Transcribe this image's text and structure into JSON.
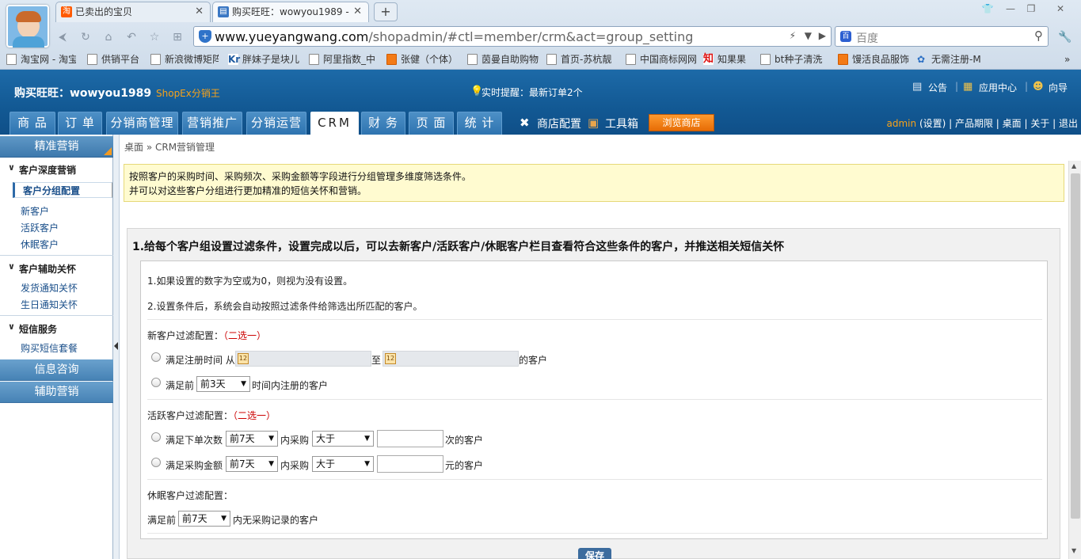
{
  "browser": {
    "tabs": [
      {
        "label": "已卖出的宝贝",
        "icon": "taobao-icon",
        "active": false
      },
      {
        "label": "购买旺旺：wowyou1989 -",
        "icon": "page-icon",
        "active": true
      }
    ],
    "new_tab": "+",
    "url_host": "www.yueyangwang.com",
    "url_path": "/shopadmin/#ctl=member/crm&act=group_setting",
    "search_placeholder": "百度",
    "bookmarks": [
      "淘宝网 - 淘宝",
      "供销平台",
      "新浪微博矩阵",
      "胖妹子是块儿",
      "阿里指数_中",
      "张健（个体）",
      "茵曼自助购物",
      "首页-苏杭靓",
      "中国商标网网",
      "知果果",
      "bt种子清洗",
      "馒活良品服饰",
      "无需注册-M"
    ],
    "bookmarks_more": "»"
  },
  "header": {
    "site_title": "购买旺旺：wowyou1989",
    "brand": "ShopEx分销王",
    "alert": "实时提醒：最新订单2个",
    "top_links": [
      "公告",
      "应用中心",
      "向导"
    ],
    "menu_tabs": [
      "商 品",
      "订 单",
      "分销商管理",
      "营销推广",
      "分销运营",
      "CRM",
      "财 务",
      "页 面",
      "统 计"
    ],
    "active_tab": "CRM",
    "tools": [
      "商店配置",
      "工具箱"
    ],
    "browse_button": "浏览商店",
    "user": "admin",
    "user_links": "(设置) | 产品期限 | 桌面 | 关于 | 退出"
  },
  "sidebar": {
    "header": "精准营销",
    "groups": [
      {
        "title": "客户深度营销",
        "items": [
          "客户分组配置",
          "新客户",
          "活跃客户",
          "休眠客户"
        ]
      },
      {
        "title": "客户辅助关怀",
        "items": [
          "发货通知关怀",
          "生日通知关怀"
        ]
      },
      {
        "title": "短信服务",
        "items": [
          "购买短信套餐"
        ]
      }
    ],
    "selected": "客户分组配置",
    "bottom_sections": [
      "信息咨询",
      "辅助营销"
    ]
  },
  "content": {
    "breadcrumb": "桌面 » CRM营销管理",
    "notice_line1": "按照客户的采购时间、采购频次、采购金额等字段进行分组管理多维度筛选条件。",
    "notice_line2": "并可以对这些客户分组进行更加精准的短信关怀和营销。",
    "panel_title": "1.给每个客户组设置过滤条件，设置完成以后，可以去新客户/活跃客户/休眠客户栏目查看符合这些条件的客户，并推送相关短信关怀",
    "tip1": "1.如果设置的数字为空或为0，则视为没有设置。",
    "tip2": "2.设置条件后，系统会自动按照过滤条件给筛选出所匹配的客户。",
    "new_title": "新客户过滤配置：",
    "choose_one": "（二选一）",
    "new_opt1_prefix": "满足注册时间 从",
    "new_opt1_mid": "至",
    "new_opt1_suffix": "的客户",
    "new_opt2_prefix": "满足前",
    "new_opt2_select": "前3天",
    "new_opt2_suffix": "时间内注册的客户",
    "active_title": "活跃客户过滤配置：",
    "active_opt1_prefix": "满足下单次数",
    "active_opt1_select": "前7天",
    "active_mid": "内采购",
    "active_cmp": "大于",
    "active_opt1_suffix": "次的客户",
    "active_opt2_prefix": "满足采购金额",
    "active_opt2_select": "前7天",
    "active_opt2_suffix": "元的客户",
    "sleep_title": "休眠客户过滤配置：",
    "sleep_prefix": "满足前",
    "sleep_select": "前7天",
    "sleep_suffix": "内无采购记录的客户",
    "save_button": "保存"
  }
}
